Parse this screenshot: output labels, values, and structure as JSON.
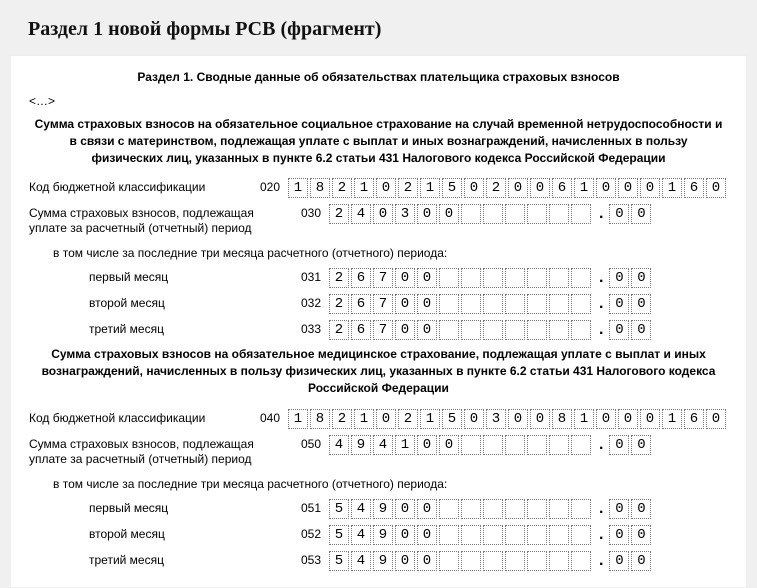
{
  "page_title": "Раздел 1 новой формы РСВ (фрагмент)",
  "form_title": "Раздел 1. Сводные данные об обязательствах плательщика страховых взносов",
  "ellipsis": "<…>",
  "section1_heading": "Сумма страховых взносов на обязательное социальное страхование на случай временной нетрудоспособности и в связи с материнством, подлежащая уплате с выплат и иных вознаграждений, начисленных в пользу физических лиц, указанных в пункте 6.2 статьи 431 Налогового кодекса Российской Федерации",
  "section2_heading": "Сумма страховых взносов на обязательное медицинское страхование, подлежащая уплате с выплат и иных вознаграждений, начисленных в пользу физических лиц, указанных в пункте 6.2 статьи 431 Налогового кодекса Российской Федерации",
  "labels": {
    "kbk": "Код бюджетной классификации",
    "sum_period": "Сумма страховых взносов, подлежащая уплате за расчетный (отчетный) период",
    "sub_months": "в том числе за последние три месяца расчетного (отчетного) периода:",
    "m1": "первый месяц",
    "m2": "второй месяц",
    "m3": "третий месяц"
  },
  "rows": {
    "r020": {
      "code": "020",
      "int": "18210215020061000160",
      "dec": null,
      "int_len": 20
    },
    "r030": {
      "code": "030",
      "int": "240300",
      "dec": "00",
      "int_len": 12
    },
    "r031": {
      "code": "031",
      "int": "26700",
      "dec": "00",
      "int_len": 12
    },
    "r032": {
      "code": "032",
      "int": "26700",
      "dec": "00",
      "int_len": 12
    },
    "r033": {
      "code": "033",
      "int": "26700",
      "dec": "00",
      "int_len": 12
    },
    "r040": {
      "code": "040",
      "int": "18210215030081000160",
      "dec": null,
      "int_len": 20
    },
    "r050": {
      "code": "050",
      "int": "494100",
      "dec": "00",
      "int_len": 12
    },
    "r051": {
      "code": "051",
      "int": "54900",
      "dec": "00",
      "int_len": 12
    },
    "r052": {
      "code": "052",
      "int": "54900",
      "dec": "00",
      "int_len": 12
    },
    "r053": {
      "code": "053",
      "int": "54900",
      "dec": "00",
      "int_len": 12
    }
  }
}
